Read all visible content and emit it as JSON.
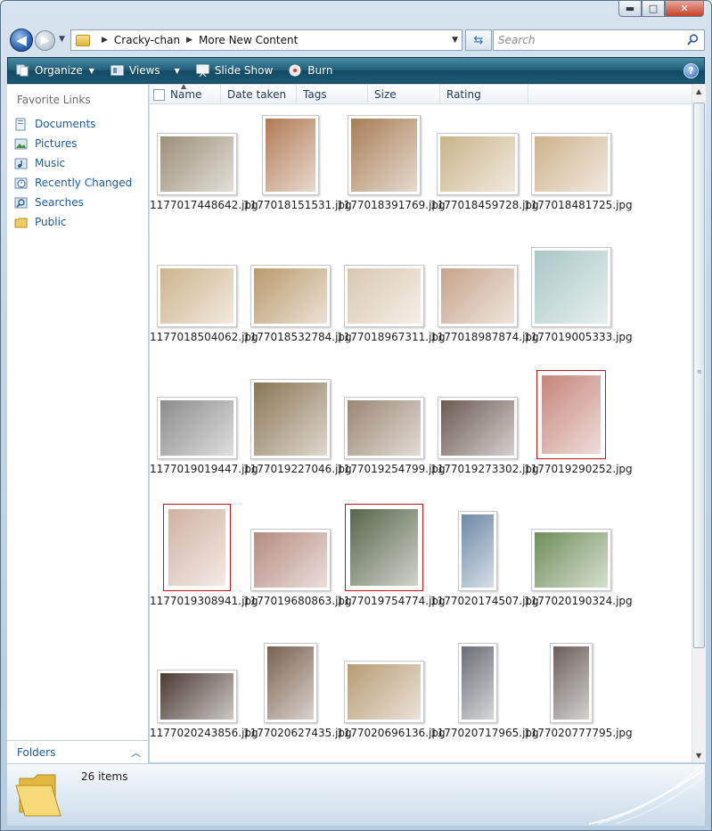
{
  "window": {
    "caption_buttons": [
      "minimize-icon",
      "maximize-icon",
      "close-icon"
    ]
  },
  "address": {
    "crumbs": [
      "Cracky-chan",
      "More New Content"
    ],
    "search_placeholder": "Search"
  },
  "commandbar": {
    "organize": "Organize",
    "views": "Views",
    "slideshow": "Slide Show",
    "burn": "Burn"
  },
  "navpane": {
    "title": "Favorite Links",
    "items": [
      {
        "label": "Documents",
        "icon": "documents-icon"
      },
      {
        "label": "Pictures",
        "icon": "pictures-icon"
      },
      {
        "label": "Music",
        "icon": "music-icon"
      },
      {
        "label": "Recently Changed",
        "icon": "recently-changed-icon"
      },
      {
        "label": "Searches",
        "icon": "searches-icon"
      },
      {
        "label": "Public",
        "icon": "public-folder-icon"
      }
    ],
    "folders_label": "Folders"
  },
  "columns": [
    "Name",
    "Date taken",
    "Tags",
    "Size",
    "Rating"
  ],
  "files": [
    {
      "name": "1177017448642.jpg",
      "color": "#9b8f78"
    },
    {
      "name": "1177018151531.jpg",
      "color": "#b07a55"
    },
    {
      "name": "1177018391769.jpg",
      "color": "#a67e56"
    },
    {
      "name": "1177018459728.jpg",
      "color": "#c9b48a"
    },
    {
      "name": "1177018481725.jpg",
      "color": "#cdb28c"
    },
    {
      "name": "1177018504062.jpg",
      "color": "#cdb48e"
    },
    {
      "name": "1177018532784.jpg",
      "color": "#b99a6c"
    },
    {
      "name": "1177018967311.jpg",
      "color": "#d8c8b0"
    },
    {
      "name": "1177018987874.jpg",
      "color": "#c6a48a"
    },
    {
      "name": "1177019005333.jpg",
      "color": "#a9c7c6"
    },
    {
      "name": "1177019019447.jpg",
      "color": "#8c8c8c"
    },
    {
      "name": "1177019227046.jpg",
      "color": "#8a7654"
    },
    {
      "name": "1177019254799.jpg",
      "color": "#9a8672"
    },
    {
      "name": "1177019273302.jpg",
      "color": "#6b5a52"
    },
    {
      "name": "1177019290252.jpg",
      "color": "#c6857a"
    },
    {
      "name": "1177019308941.jpg",
      "color": "#d1b2a2"
    },
    {
      "name": "1177019680863.jpg",
      "color": "#b58c80"
    },
    {
      "name": "1177019754774.jpg",
      "color": "#57654a"
    },
    {
      "name": "1177020174507.jpg",
      "color": "#6d8aa6"
    },
    {
      "name": "1177020190324.jpg",
      "color": "#6f8e5a"
    },
    {
      "name": "1177020243856.jpg",
      "color": "#4a3a33"
    },
    {
      "name": "1177020627435.jpg",
      "color": "#7a6250"
    },
    {
      "name": "1177020696136.jpg",
      "color": "#b79c74"
    },
    {
      "name": "1177020717965.jpg",
      "color": "#6c6e76"
    },
    {
      "name": "1177020777795.jpg",
      "color": "#6a5f5a"
    }
  ],
  "status": {
    "item_count": "26 items"
  }
}
